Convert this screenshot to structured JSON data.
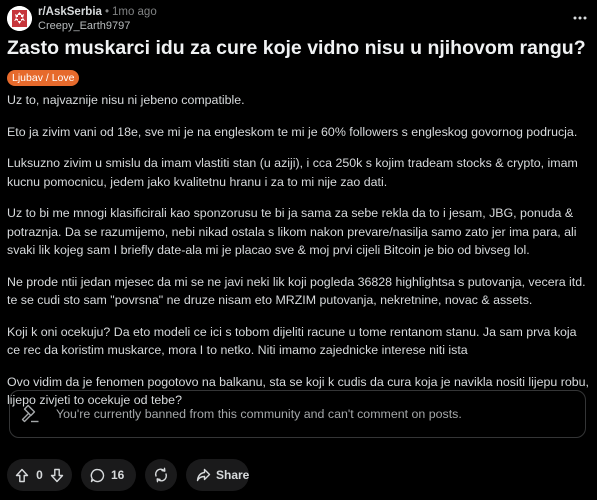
{
  "post": {
    "subreddit": "r/AskSerbia",
    "time": "1mo ago",
    "username": "Creepy_Earth9797",
    "title": "Zasto muskarci idu za cure koje vidno nisu u njihovom rangu?",
    "flair": "Ljubav / Love",
    "paragraphs": [
      "Uz to, najvaznije nisu ni jebeno compatible.",
      "Eto ja zivim vani od 18e, sve mi je na engleskom te mi je 60% followers s engleskog govornog podrucja.",
      "Luksuzno zivim u smislu da imam vlastiti stan (u aziji), i cca 250k s kojim tradeam stocks & crypto, imam kucnu pomocnicu, jedem jako kvalitetnu hranu i za to mi nije zao dati.",
      "Uz to bi me mnogi klasificirali kao sponzorusu te bi ja sama za sebe rekla da to i jesam, JBG, ponuda & potraznja. Da se razumijemo, nebi nikad ostala s likom nakon prevare/nasilja samo zato jer ima para, ali svaki lik kojeg sam I briefly date-ala mi je placao sve & moj prvi cijeli Bitcoin je bio od bivseg lol.",
      "Ne prode ntii jedan mjesec da mi se ne javi neki lik koji pogleda 36828 highlightsa s putovanja, vecera itd. te se cudi sto sam \"povrsna\" ne druze nisam eto MRZIM putovanja, nekretnine, novac & assets.",
      "Koji k oni ocekuju? Da eto modeli ce ici s tobom dijeliti racune u tome rentanom stanu. Ja sam prva koja ce rec da koristim muskarce, mora I to netko. Niti imamo zajednicke interese niti ista",
      "Ovo vidim da je fenomen pogotovo na balkanu, sta se koji k cudis da cura koja je navikla nositi lijepu robu, lijepo zivjeti to ocekuje od tebe?"
    ]
  },
  "banned_notice": "You're currently banned from this community and can't comment on posts.",
  "actions": {
    "vote_count": "0",
    "comment_count": "16",
    "share_label": "Share"
  },
  "icons": {
    "avatar": "serbian-coat-of-arms-icon",
    "more": "more-horizontal-icon",
    "banned": "gavel-icon",
    "upvote": "upvote-arrow-icon",
    "downvote": "downvote-arrow-icon",
    "comment": "comment-bubble-icon",
    "repost": "repost-icon",
    "share": "share-arrow-icon"
  },
  "colors": {
    "background": "#000000",
    "flair_bg": "#e66a2c",
    "pill_bg": "#1a1a1b",
    "text": "#d7dadc",
    "muted": "#818384"
  }
}
